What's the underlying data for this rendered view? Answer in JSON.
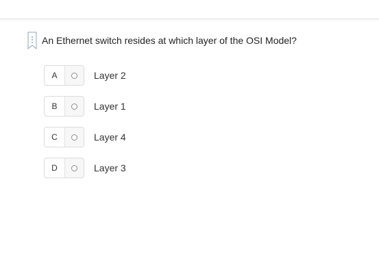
{
  "question": {
    "text": "An Ethernet switch resides at which layer of the OSI Model?",
    "bookmark_icon": "bookmark-flag-icon"
  },
  "options": [
    {
      "letter": "A",
      "label": "Layer 2",
      "selected": false
    },
    {
      "letter": "B",
      "label": "Layer 1",
      "selected": false
    },
    {
      "letter": "C",
      "label": "Layer 4",
      "selected": false
    },
    {
      "letter": "D",
      "label": "Layer 3",
      "selected": false
    }
  ],
  "colors": {
    "border": "#dcdcdc",
    "bookmark": "#8fa4b8",
    "radio": "#8a8a8a"
  }
}
